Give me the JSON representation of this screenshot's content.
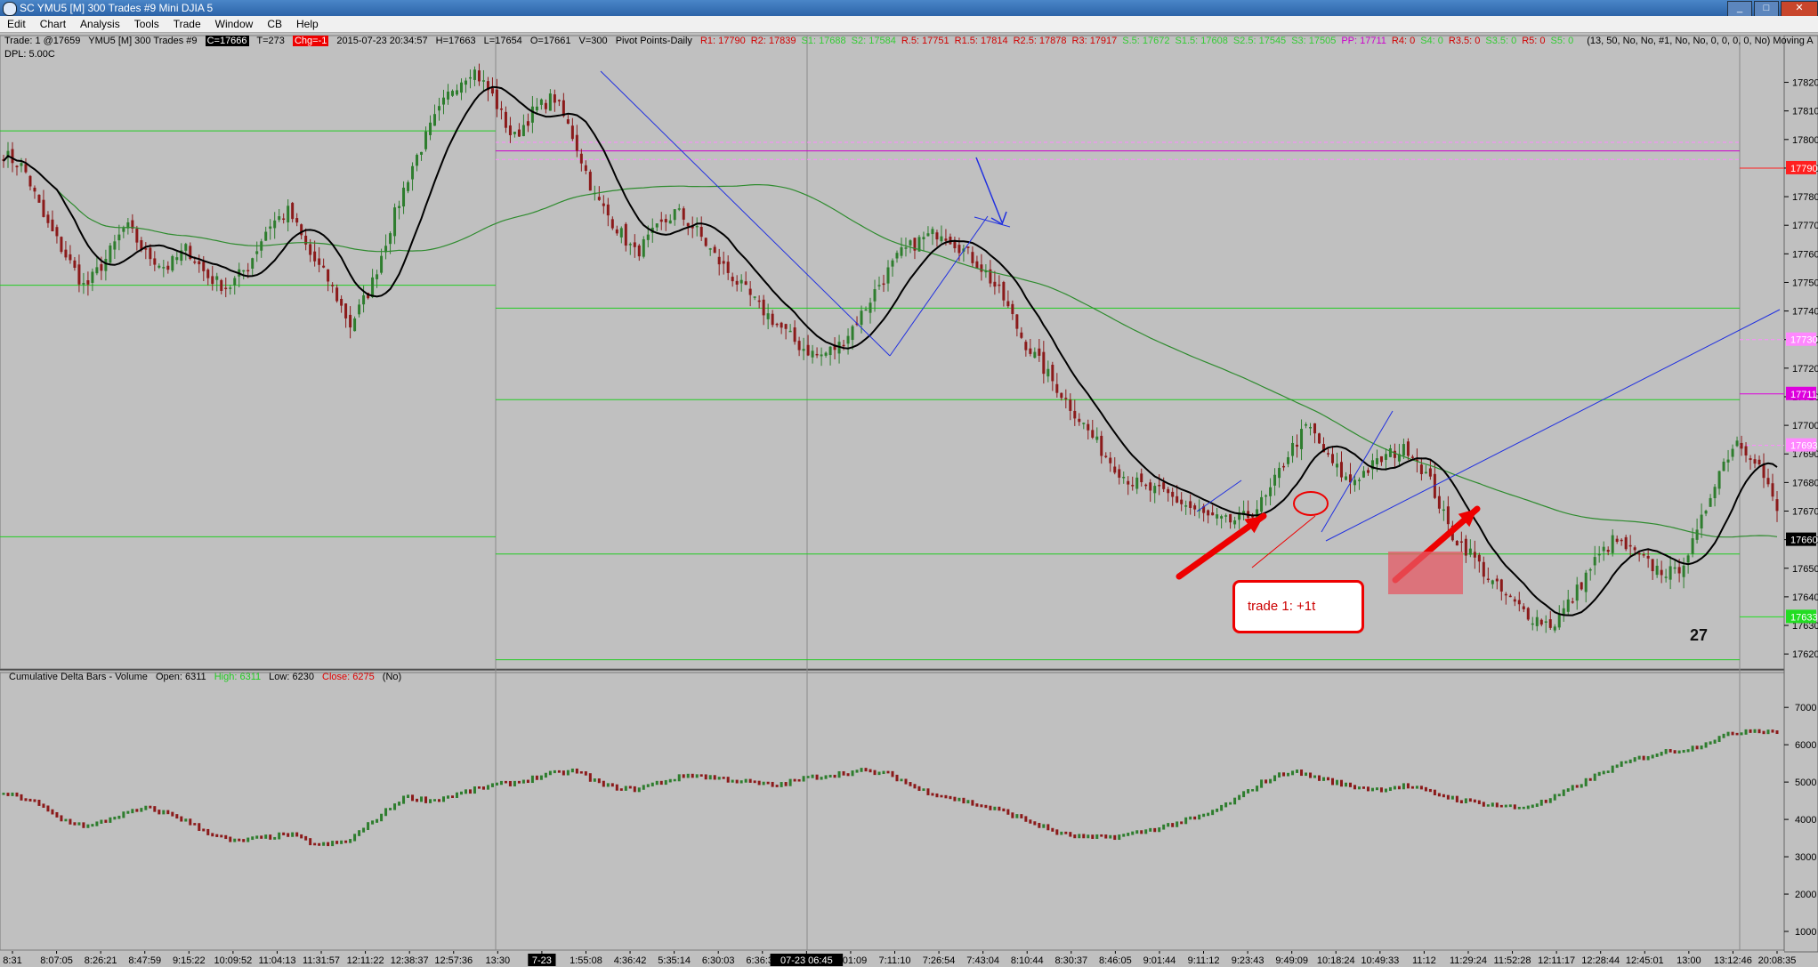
{
  "window": {
    "title": "SC YMU5 [M]  300 Trades  #9  Mini DJIA 5",
    "controls": [
      "minimize",
      "maximize",
      "close"
    ]
  },
  "menu": [
    "Edit",
    "Chart",
    "Analysis",
    "Tools",
    "Trade",
    "Window",
    "CB",
    "Help"
  ],
  "header": {
    "trade_info": "Trade: 1 @17659",
    "symbol": "YMU5 [M]  300 Trades  #9",
    "close_badge": "C=17666",
    "ticks": "T=273",
    "chg_badge": "Chg=-1",
    "datetime": "2015-07-23  20:34:57",
    "high": "H=17663",
    "low": "L=17654",
    "open": "O=17661",
    "volume": "V=300",
    "study": "Pivot Points-Daily",
    "pivots": [
      {
        "text": "R1: 17790",
        "color": "#d00000"
      },
      {
        "text": "R2: 17839",
        "color": "#d00000"
      },
      {
        "text": "S1: 17688",
        "color": "#33cc33"
      },
      {
        "text": "S2: 17584",
        "color": "#33cc33"
      },
      {
        "text": "R.5: 17751",
        "color": "#d00000"
      },
      {
        "text": "R1.5: 17814",
        "color": "#d00000"
      },
      {
        "text": "R2.5: 17878",
        "color": "#d00000"
      },
      {
        "text": "R3: 17917",
        "color": "#d00000"
      },
      {
        "text": "S.5: 17672",
        "color": "#33cc33"
      },
      {
        "text": "S1.5: 17608",
        "color": "#33cc33"
      },
      {
        "text": "S2.5: 17545",
        "color": "#33cc33"
      },
      {
        "text": "S3: 17505",
        "color": "#33cc33"
      },
      {
        "text": "PP: 17711",
        "color": "#cc00cc"
      },
      {
        "text": "R4: 0",
        "color": "#d00000"
      },
      {
        "text": "S4: 0",
        "color": "#33cc33"
      },
      {
        "text": "R3.5: 0",
        "color": "#d00000"
      },
      {
        "text": "S3.5: 0",
        "color": "#33cc33"
      },
      {
        "text": "R5: 0",
        "color": "#d00000"
      },
      {
        "text": "S5: 0",
        "color": "#33cc33"
      }
    ],
    "params": "(13, 50, No, No, #1, No, No, 0, 0, 0, 0, No)  Moving A",
    "dpl": "DPL: 5.00C"
  },
  "price_axis": {
    "ticks": [
      "17820",
      "17810",
      "17800",
      "17790",
      "17780",
      "17770",
      "17760",
      "17750",
      "17740",
      "17730",
      "17720",
      "17710",
      "17700",
      "17690",
      "17680",
      "17670",
      "17660",
      "17650",
      "17640",
      "17630",
      "17620"
    ],
    "markers": [
      {
        "text": "17790",
        "color": "#ff2020",
        "value": 17790
      },
      {
        "text": "17730",
        "color": "#ff88ff",
        "value": 17730
      },
      {
        "text": "17711",
        "color": "#dd00dd",
        "value": 17711
      },
      {
        "text": "17693",
        "color": "#ff88ff",
        "value": 17693
      },
      {
        "text": "17660",
        "color": "#000000",
        "value": 17660
      },
      {
        "text": "17633",
        "color": "#22dd22",
        "value": 17633
      }
    ]
  },
  "delta_axis": {
    "ticks": [
      "7000",
      "6000",
      "5000",
      "4000",
      "3000",
      "2000",
      "1000"
    ]
  },
  "time_axis": {
    "labels": [
      "8:31",
      "8:07:05",
      "8:26:21",
      "8:47:59",
      "9:15:22",
      "10:09:52",
      "11:04:13",
      "11:31:57",
      "12:11:22",
      "12:38:37",
      "12:57:36",
      "13:30",
      "7-23",
      "1:55:08",
      "4:36:42",
      "5:35:14",
      "6:30:03",
      "6:36:36",
      "07-23  06:45",
      "7:01:09",
      "7:11:10",
      "7:26:54",
      "7:43:04",
      "8:10:44",
      "8:30:37",
      "8:46:05",
      "9:01:44",
      "9:11:12",
      "9:23:43",
      "9:49:09",
      "10:18:24",
      "10:49:33",
      "11:12",
      "11:29:24",
      "11:52:28",
      "12:11:17",
      "12:28:44",
      "12:45:01",
      "13:00",
      "13:12:46",
      "20:08:35"
    ]
  },
  "delta_panel": {
    "title": "Cumulative Delta Bars - Volume",
    "open": "Open: 6311",
    "high": "High: 6311",
    "low": "Low: 6230",
    "close": "Close: 6275",
    "flag": "(No)"
  },
  "annotations": {
    "trade_box": "trade 1: +1t",
    "big_number": "27"
  },
  "colors": {
    "background": "#c0c0c0",
    "up_bar": "#2e7d2e",
    "down_bar": "#8b1a1a",
    "ma_fast": "#000000",
    "ma_slow": "#2e8b2e",
    "pivot_green": "#22dd22",
    "pivot_magenta": "#cc00cc",
    "trendline": "#2030e0",
    "annotation_red": "#e00000"
  },
  "chart_data": {
    "type": "candlestick",
    "price_range": [
      17616,
      17832
    ],
    "delta_range": [
      500,
      7600
    ],
    "price_path": [
      17795,
      17790,
      17772,
      17760,
      17748,
      17758,
      17770,
      17760,
      17755,
      17762,
      17752,
      17748,
      17756,
      17770,
      17775,
      17760,
      17750,
      17735,
      17748,
      17770,
      17790,
      17805,
      17818,
      17825,
      17815,
      17800,
      17810,
      17815,
      17800,
      17780,
      17770,
      17760,
      17768,
      17775,
      17768,
      17758,
      17750,
      17742,
      17735,
      17728,
      17724,
      17728,
      17738,
      17750,
      17760,
      17765,
      17768,
      17762,
      17755,
      17745,
      17730,
      17720,
      17710,
      17700,
      17690,
      17682,
      17678,
      17676,
      17672,
      17668,
      17666,
      17668,
      17675,
      17690,
      17700,
      17688,
      17680,
      17685,
      17690,
      17692,
      17680,
      17662,
      17655,
      17645,
      17638,
      17633,
      17630,
      17640,
      17652,
      17660,
      17655,
      17650,
      17648,
      17660,
      17682,
      17695,
      17688,
      17670
    ],
    "delta_path": [
      4700,
      4500,
      4000,
      3800,
      4100,
      4300,
      4100,
      3700,
      3400,
      3500,
      3600,
      3300,
      3400,
      4000,
      4600,
      4500,
      4700,
      4900,
      5000,
      5200,
      5300,
      4900,
      4800,
      5000,
      5200,
      5100,
      5000,
      4900,
      5100,
      5200,
      5300,
      5200,
      4800,
      4600,
      4400,
      4200,
      3900,
      3600,
      3500,
      3550,
      3700,
      3900,
      4100,
      4500,
      5000,
      5300,
      5100,
      4900,
      4800,
      4900,
      4700,
      4500,
      4400,
      4300,
      4500,
      4900,
      5300,
      5600,
      5800,
      5900,
      6200,
      6400,
      6350
    ]
  }
}
